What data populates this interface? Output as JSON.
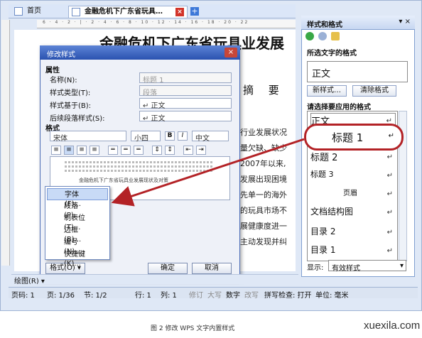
{
  "tabs": {
    "home": "首页",
    "doc": "金融危机下广东省玩具…",
    "close": "×",
    "add": "+"
  },
  "ruler": {
    "marks": "6 · 4 · 2 · | · 2 · 4 · 6 · 8 · 10 · 12 · 14 · 16 · 18 · 20 · 22"
  },
  "document": {
    "title": "金融危机下广东省玩具业发展",
    "abstract": "摘 要",
    "lines": [
      "行业发展状况",
      "量欠缺、缺少",
      "2007年以来,",
      "发展出现困境",
      "先单一的海外",
      "的玩具市场不",
      "展健康度进一",
      "主动发现并纠"
    ]
  },
  "pane": {
    "title": "样式和格式",
    "selected_text_heading": "所选文字的格式",
    "current_format": "正文",
    "new_style": "新样式…",
    "clear_format": "清除格式",
    "apply_heading": "请选择要应用的格式",
    "styles": [
      "正文",
      "标题 1",
      "标题 2",
      "标题 3",
      "页眉",
      "文档结构图",
      "目录 2",
      "目录 1"
    ],
    "arrow": "↵",
    "show_label": "显示:",
    "show_value": "有效样式"
  },
  "dialog": {
    "title": "修改样式",
    "close": "×",
    "props_heading": "属性",
    "name_label": "名称(N):",
    "name_value": "标题 1",
    "type_label": "样式类型(T):",
    "type_value": "段落",
    "based_label": "样式基于(B):",
    "based_value": "↵ 正文",
    "next_label": "后续段落样式(S):",
    "next_value": "↵ 正文",
    "format_heading": "格式",
    "font": "宋体",
    "size": "小四",
    "bold": "B",
    "italic": "I",
    "lang": "中文",
    "preview_text": "金融危机下广东省玩具业发展现状及对策",
    "format_btn": "格式(O) ▾",
    "ok": "确定",
    "cancel": "取消"
  },
  "format_menu": [
    "字体(F)...",
    "段落(P)...",
    "制表位(T)...",
    "边框(B)...",
    "编号(N)...",
    "快捷键(K)..."
  ],
  "toolbar": {
    "draw": "绘图(R) ▾"
  },
  "status": {
    "page_num": "页码: 1",
    "page": "页: 1/36",
    "section": "节: 1/2",
    "row": "行: 1",
    "col": "列: 1",
    "rev": "修订",
    "caps": "大写",
    "num": "数字",
    "ovr": "改写",
    "spell": "拼写检查: 打开",
    "unit": "单位: 毫米"
  },
  "caption": "图 2    修改 WPS 文字内置样式",
  "watermark": "xuexila.com",
  "colors": {
    "highlight": "#b32226",
    "titlebar": "#2a52b0"
  }
}
